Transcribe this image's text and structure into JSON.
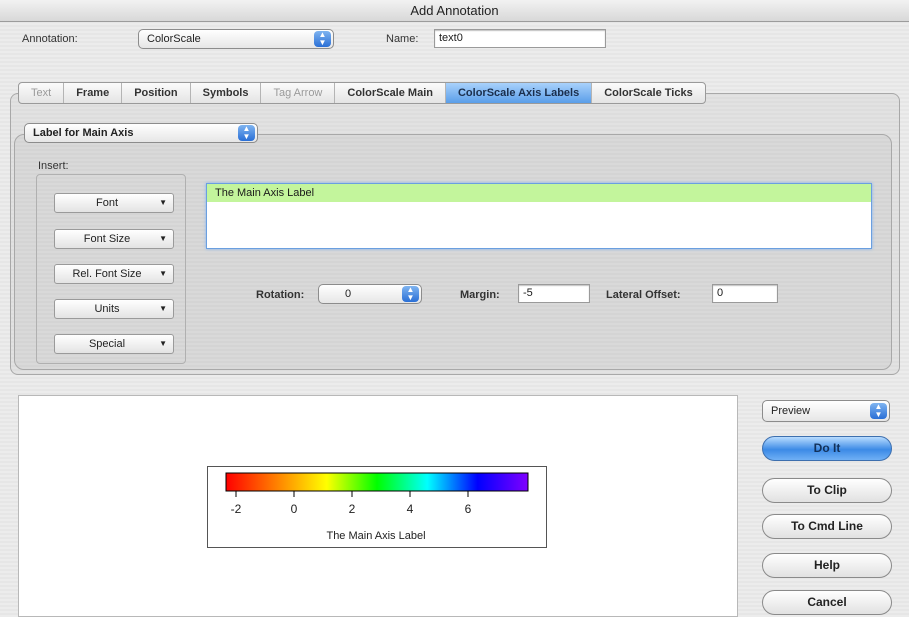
{
  "window": {
    "title": "Add Annotation"
  },
  "annotation": {
    "label": "Annotation:",
    "value": "ColorScale"
  },
  "name": {
    "label": "Name:",
    "value": "text0"
  },
  "tabs": [
    {
      "label": "Text",
      "state": "disabled"
    },
    {
      "label": "Frame",
      "state": "normal"
    },
    {
      "label": "Position",
      "state": "normal"
    },
    {
      "label": "Symbols",
      "state": "normal"
    },
    {
      "label": "Tag Arrow",
      "state": "disabled"
    },
    {
      "label": "ColorScale Main",
      "state": "normal"
    },
    {
      "label": "ColorScale Axis Labels",
      "state": "active"
    },
    {
      "label": "ColorScale Ticks",
      "state": "normal"
    }
  ],
  "axis_select": {
    "value": "Label for Main Axis"
  },
  "insert": {
    "label": "Insert:",
    "buttons": [
      "Font",
      "Font Size",
      "Rel. Font Size",
      "Units",
      "Special"
    ]
  },
  "label_text": {
    "value": "The Main Axis Label"
  },
  "rotation": {
    "label": "Rotation:",
    "value": "0"
  },
  "margin": {
    "label": "Margin:",
    "value": "-5"
  },
  "lateral_offset": {
    "label": "Lateral Offset:",
    "value": "0"
  },
  "colorscale_preview": {
    "tick_labels": [
      "-2",
      "0",
      "2",
      "4",
      "6"
    ],
    "axis_label": "The Main Axis Label",
    "gradient": [
      "#ff0000",
      "#ff8000",
      "#ffff00",
      "#00ff00",
      "#00ffff",
      "#0000ff",
      "#8000ff"
    ]
  },
  "actions": {
    "preview_select": "Preview",
    "do_it": "Do It",
    "to_clip": "To Clip",
    "to_cmd_line": "To Cmd Line",
    "help": "Help",
    "cancel": "Cancel"
  }
}
